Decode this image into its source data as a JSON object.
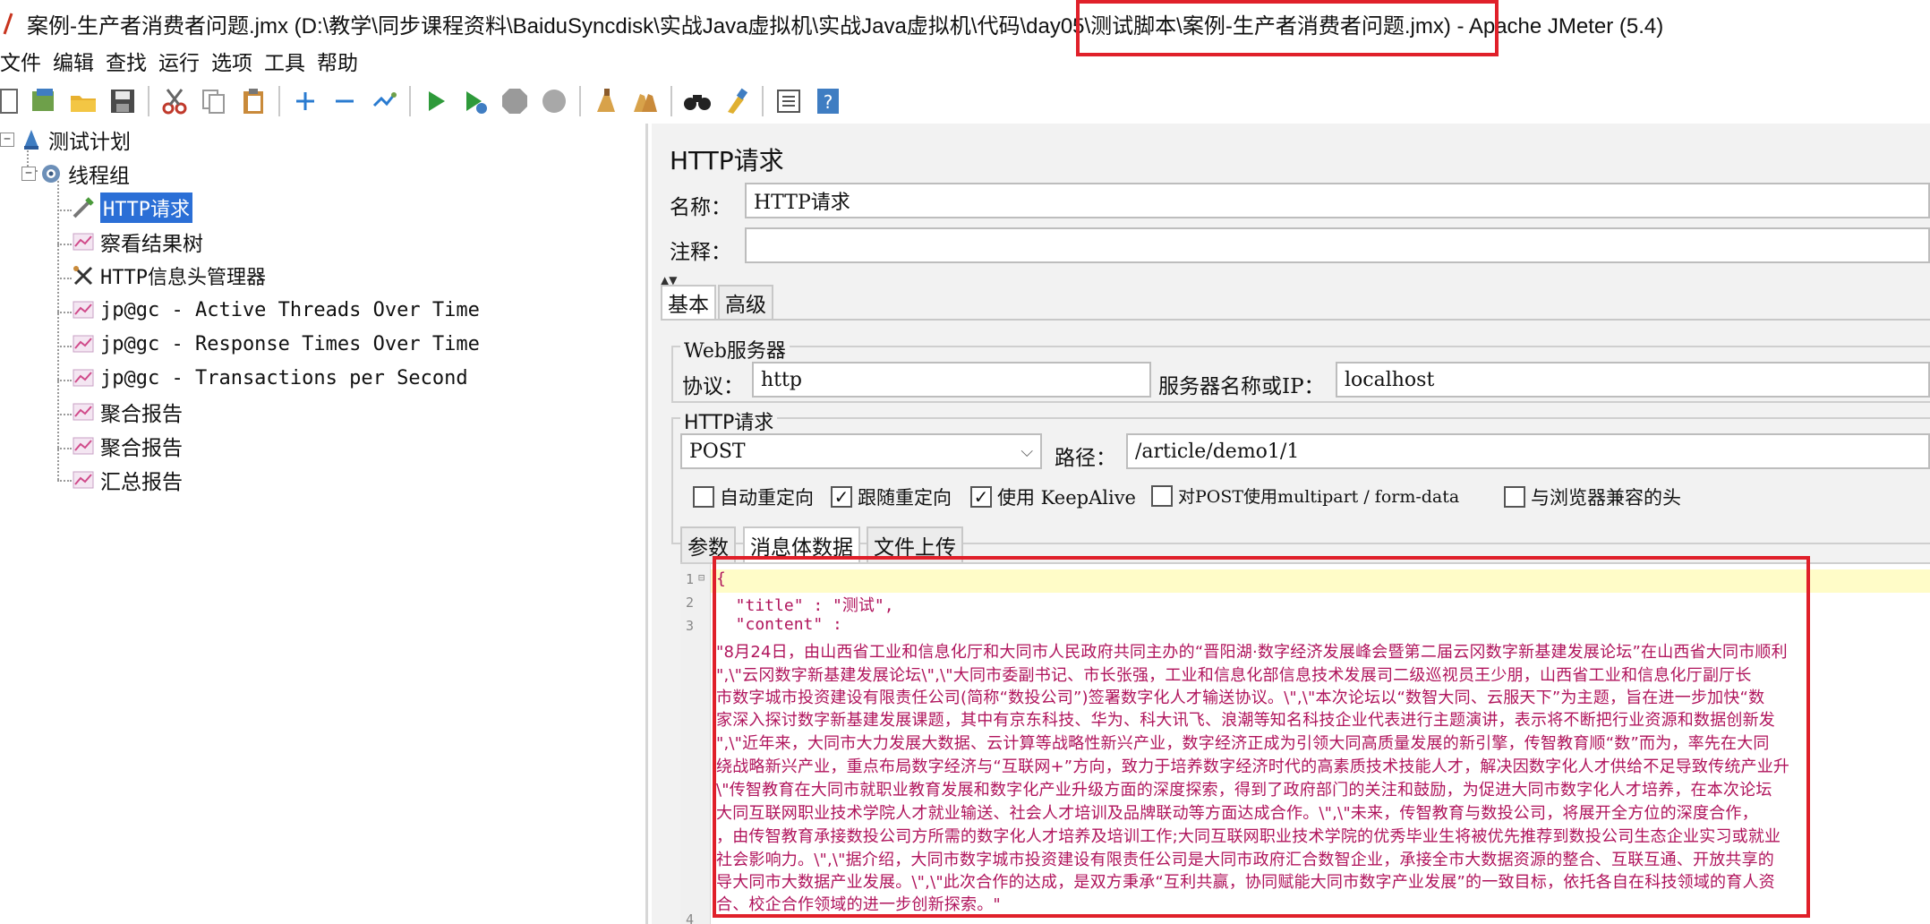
{
  "window": {
    "title": "案例-生产者消费者问题.jmx (D:\\教学\\同步课程资料\\BaiduSyncdisk\\实战Java虚拟机\\实战Java虚拟机\\代码\\day05\\测试脚本\\案例-生产者消费者问题.jmx) - Apache JMeter (5.4)"
  },
  "menu": [
    "文件",
    "编辑",
    "查找",
    "运行",
    "选项",
    "工具",
    "帮助"
  ],
  "toolbar": {
    "icons": [
      "new-icon",
      "templates-icon",
      "open-icon",
      "save-icon",
      "cut-icon",
      "copy-icon",
      "paste-icon",
      "expand-icon",
      "collapse-icon",
      "toggle-icon",
      "start-icon",
      "start-no-pause-icon",
      "stop-icon",
      "shutdown-icon",
      "clear-icon",
      "clear-all-icon",
      "search-icon",
      "reset-search-icon",
      "function-helper-icon",
      "help-icon"
    ]
  },
  "tree": {
    "items": [
      {
        "label": "测试计划"
      },
      {
        "label": "线程组"
      },
      {
        "label": "HTTP请求"
      },
      {
        "label": "察看结果树"
      },
      {
        "label": "HTTP信息头管理器"
      },
      {
        "label": "jp@gc - Active Threads Over Time"
      },
      {
        "label": "jp@gc - Response Times Over Time"
      },
      {
        "label": "jp@gc - Transactions per Second"
      },
      {
        "label": "聚合报告"
      },
      {
        "label": "聚合报告"
      },
      {
        "label": "汇总报告"
      }
    ]
  },
  "panel": {
    "title": "HTTP请求",
    "name_label": "名称：",
    "name_value": "HTTP请求",
    "comment_label": "注释：",
    "comment_value": "",
    "tabs": [
      "基本",
      "高级"
    ],
    "web_server": {
      "group_title": "Web服务器",
      "protocol_label": "协议：",
      "protocol_value": "http",
      "server_label": "服务器名称或IP：",
      "server_value": "localhost"
    },
    "http_request": {
      "group_title": "HTTP请求",
      "method": "POST",
      "path_label": "路径：",
      "path_value": "/article/demo1/1"
    },
    "checkboxes": [
      {
        "label": "自动重定向",
        "checked": false
      },
      {
        "label": "跟随重定向",
        "checked": true
      },
      {
        "label": "使用 KeepAlive",
        "checked": true
      },
      {
        "label": "对POST使用multipart / form-data",
        "checked": false
      },
      {
        "label": "与浏览器兼容的头",
        "checked": false
      }
    ],
    "body_tabs": [
      "参数",
      "消息体数据",
      "文件上传"
    ],
    "editor": {
      "line_numbers": [
        "1",
        "2",
        "3",
        "4"
      ],
      "lines": [
        "{",
        "  \"title\" : \"测试\",",
        "  \"content\" :"
      ],
      "content_lines": [
        "\"8月24日，由山西省工业和信息化厅和大同市人民政府共同主办的“晋阳湖·数字经济发展峰会暨第二届云冈数字新基建发展论坛”在山西省大同市顺利",
        "\",\\\"云冈数字新基建发展论坛\\\",\\\"大同市委副书记、市长张强，工业和信息化部信息技术发展司二级巡视员王少朋，山西省工业和信息化厅副厅长",
        "市数字城市投资建设有限责任公司(简称“数投公司”)签署数字化人才输送协议。\\\",\\\"本次论坛以“数智大同、云服天下”为主题，旨在进一步加快“数",
        "家深入探讨数字新基建发展课题，其中有京东科技、华为、科大讯飞、浪潮等知名科技企业代表进行主题演讲，表示将不断把行业资源和数据创新发",
        "\",\\\"近年来，大同市大力发展大数据、云计算等战略性新兴产业，数字经济正成为引领大同高质量发展的新引擎，传智教育顺“数”而为，率先在大同",
        "绕战略新兴产业，重点布局数字经济与“互联网+”方向，致力于培养数字经济时代的高素质技术技能人才，解决因数字化人才供给不足导致传统产业升",
        "\\\"传智教育在大同市就职业教育发展和数字化产业升级方面的深度探索，得到了政府部门的关注和鼓励，为促进大同市数字化人才培养，在本次论坛",
        "大同互联网职业技术学院人才就业输送、社会人才培训及品牌联动等方面达成合作。\\\",\\\"未来，传智教育与数投公司，将展开全方位的深度合作，",
        "，由传智教育承接数投公司方所需的数字化人才培养及培训工作;大同互联网职业技术学院的优秀毕业生将被优先推荐到数投公司生态企业实习或就业",
        "社会影响力。\\\",\\\"据介绍，大同市数字城市投资建设有限责任公司是大同市政府汇合数智企业，承接全市大数据资源的整合、互联互通、开放共享的",
        "导大同市大数据产业发展。\\\",\\\"此次合作的达成，是双方秉承“互利共赢，协同赋能大同市数字产业发展”的一致目标，依托各自在科技领域的育人资",
        "合、校企合作领域的进一步创新探索。\""
      ]
    }
  },
  "colors": {
    "annotation_red": "#e0202a",
    "selection_blue": "#2b6fd6",
    "code_text": "#b0145c"
  }
}
